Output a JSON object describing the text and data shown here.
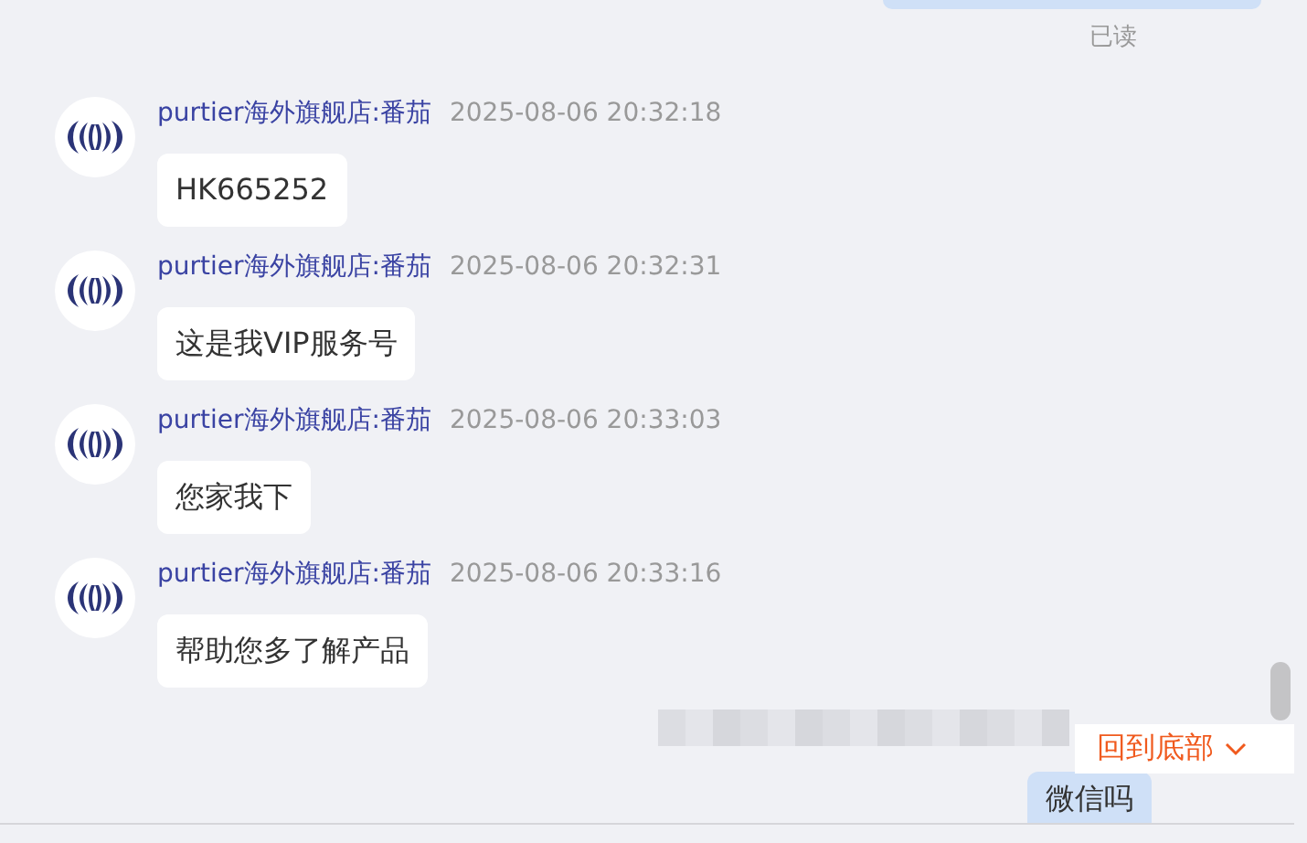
{
  "read_status": "已读",
  "messages": [
    {
      "sender": "purtier海外旗舰店:番茄",
      "time": "2025-08-06 20:32:18",
      "text": "HK665252"
    },
    {
      "sender": "purtier海外旗舰店:番茄",
      "time": "2025-08-06 20:32:31",
      "text": "这是我VIP服务号"
    },
    {
      "sender": "purtier海外旗舰店:番茄",
      "time": "2025-08-06 20:33:03",
      "text": "您家我下"
    },
    {
      "sender": "purtier海外旗舰店:番茄",
      "time": "2025-08-06 20:33:16",
      "text": "帮助您多了解产品"
    }
  ],
  "outgoing": {
    "text": "微信吗"
  },
  "back_to_bottom": {
    "label": "回到底部"
  }
}
